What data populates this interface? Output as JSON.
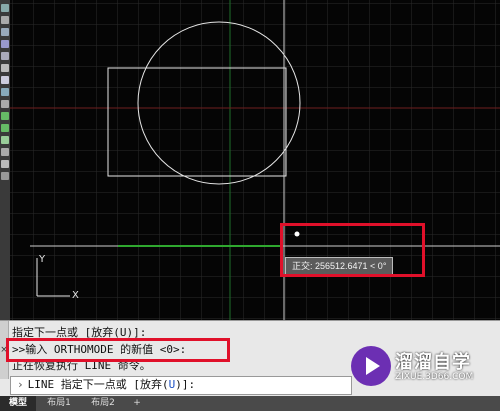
{
  "command_line": {
    "history": [
      "指定下一点或 [放弃(U)]:",
      ">>输入 ORTHOMODE 的新值 <0>:",
      "正在恢复执行 LINE 命令。"
    ],
    "prompt_prefix": "LINE 指定下一点或 [放弃(",
    "prompt_key": "U",
    "prompt_suffix": ")]:",
    "close_glyph": "×"
  },
  "cursor_tooltip": "正交: 256512.6471 < 0°",
  "ucs_icon": {
    "y_label": "Y",
    "x_label": "X"
  },
  "tabs": [
    {
      "label": "模型",
      "active": true
    },
    {
      "label": "布局1",
      "active": false
    },
    {
      "label": "布局2",
      "active": false
    },
    {
      "label": "+",
      "active": false
    }
  ],
  "watermark": {
    "title": "溜溜自学",
    "url": "ZIXUE.3D66.COM"
  },
  "colors": {
    "canvas_bg": "#050505",
    "grid": "#2a2a2a",
    "highlight": "#e0102a",
    "rubber_band": "#2fa82f",
    "axis_y": "#1f6e2a",
    "axis_x": "#6e1f1f"
  }
}
